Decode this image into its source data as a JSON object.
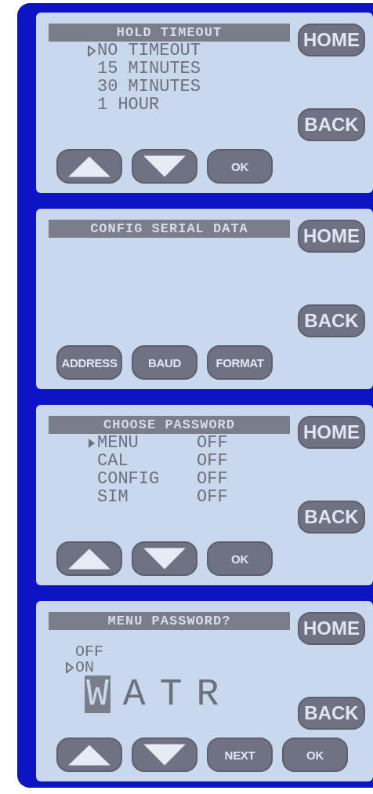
{
  "screens": [
    {
      "title": "HOLD TIMEOUT",
      "kind": "options",
      "options": [
        {
          "label": "NO TIMEOUT",
          "selected": true
        },
        {
          "label": "15 MINUTES",
          "selected": false
        },
        {
          "label": "30 MINUTES",
          "selected": false
        },
        {
          "label": "1 HOUR",
          "selected": false
        }
      ],
      "side_buttons": [
        "HOME",
        "BACK"
      ],
      "bottom_buttons": [
        {
          "kind": "up"
        },
        {
          "kind": "down"
        },
        {
          "kind": "text",
          "label": "OK"
        }
      ]
    },
    {
      "title": "CONFIG SERIAL DATA",
      "kind": "blank",
      "side_buttons": [
        "HOME",
        "BACK"
      ],
      "bottom_buttons": [
        {
          "kind": "text",
          "label": "ADDRESS"
        },
        {
          "kind": "text",
          "label": "BAUD"
        },
        {
          "kind": "text",
          "label": "FORMAT"
        }
      ]
    },
    {
      "title": "CHOOSE PASSWORD",
      "kind": "settings",
      "rows": [
        {
          "label": "MENU",
          "value": "OFF",
          "selected": true
        },
        {
          "label": "CAL",
          "value": "OFF",
          "selected": false
        },
        {
          "label": "CONFIG",
          "value": "OFF",
          "selected": false
        },
        {
          "label": "SIM",
          "value": "OFF",
          "selected": false
        }
      ],
      "side_buttons": [
        "HOME",
        "BACK"
      ],
      "bottom_buttons": [
        {
          "kind": "up"
        },
        {
          "kind": "down"
        },
        {
          "kind": "text",
          "label": "OK"
        }
      ]
    },
    {
      "title": "MENU PASSWORD?",
      "kind": "password",
      "options": [
        {
          "label": "OFF",
          "selected": false
        },
        {
          "label": "ON",
          "selected": true
        }
      ],
      "password": [
        {
          "char": "W",
          "selected": true
        },
        {
          "char": "A",
          "selected": false
        },
        {
          "char": "T",
          "selected": false
        },
        {
          "char": "R",
          "selected": false
        }
      ],
      "side_buttons": [
        "HOME",
        "BACK"
      ],
      "bottom_buttons": [
        {
          "kind": "up"
        },
        {
          "kind": "down"
        },
        {
          "kind": "text",
          "label": "NEXT"
        },
        {
          "kind": "text",
          "label": "OK"
        }
      ]
    }
  ]
}
